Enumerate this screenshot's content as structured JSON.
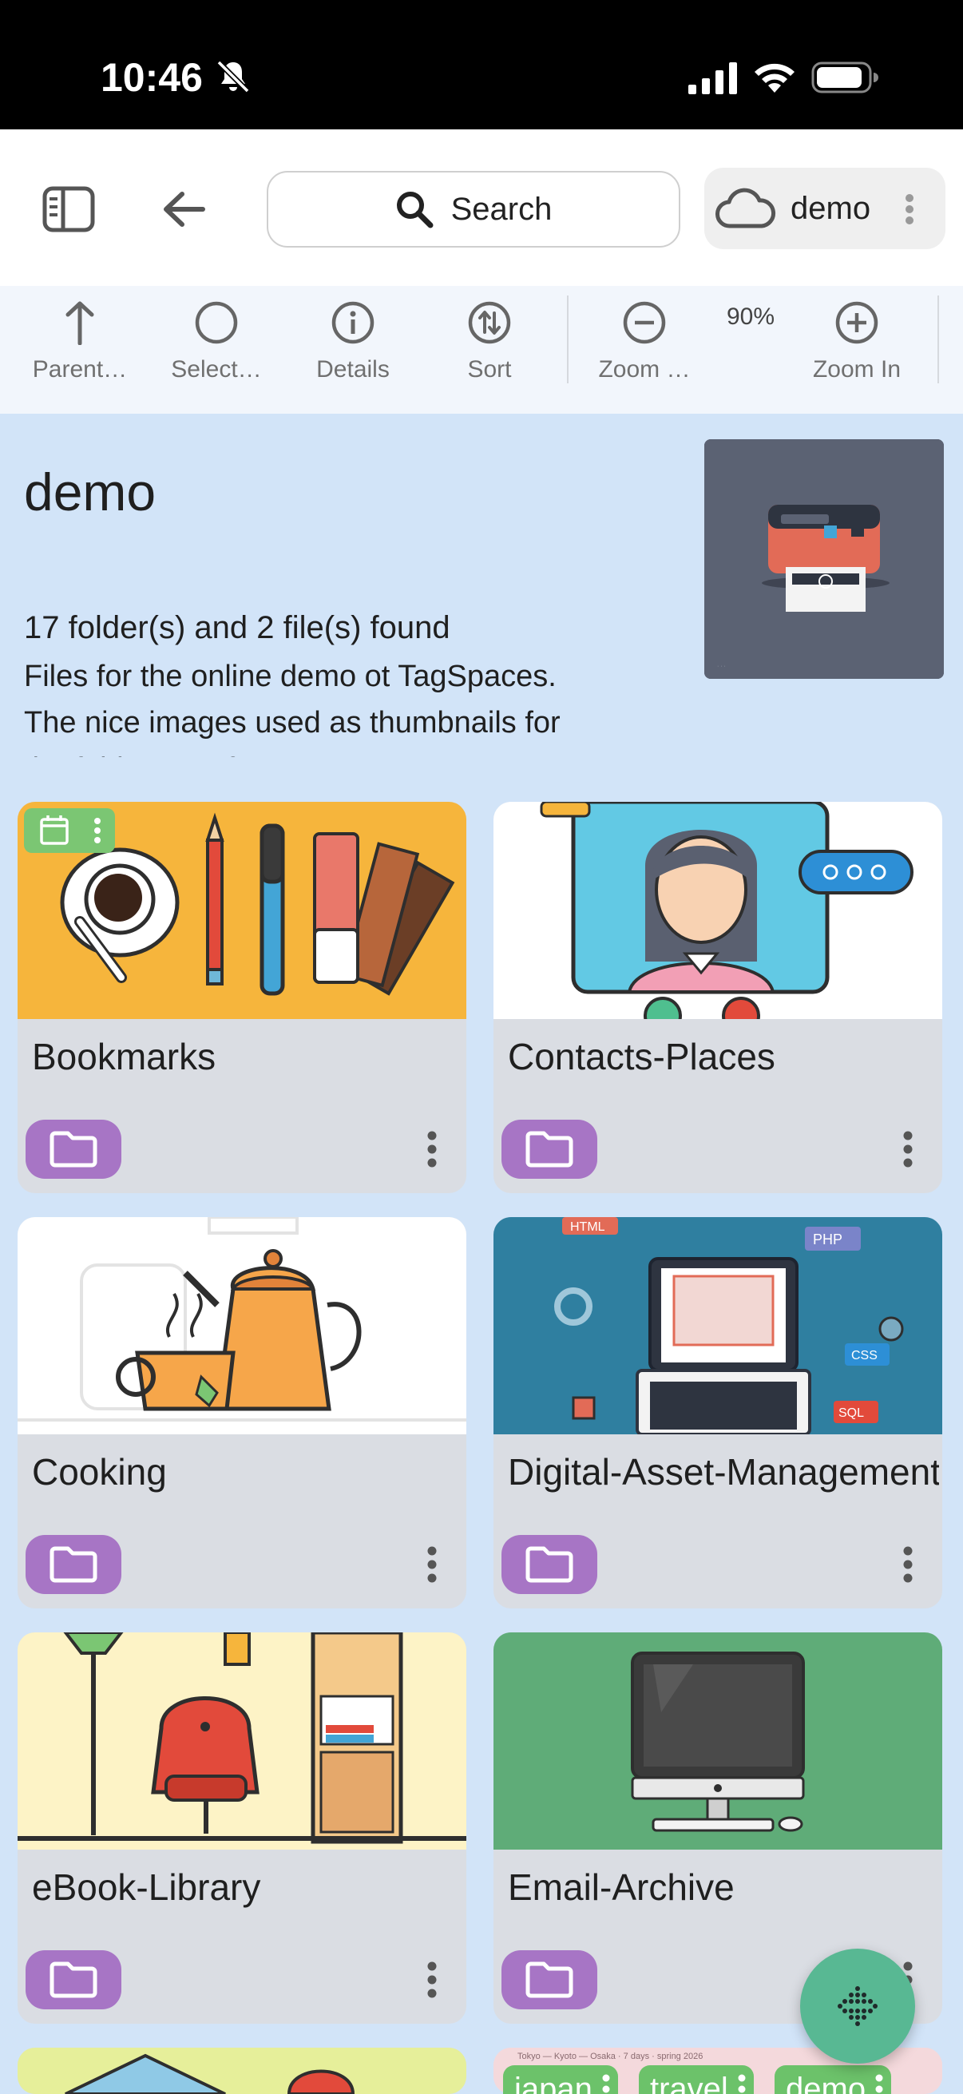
{
  "status_bar": {
    "time": "10:46"
  },
  "header": {
    "search_label": "Search",
    "location_label": "demo"
  },
  "toolbar": {
    "parent": "Parent…",
    "select": "Select…",
    "details": "Details",
    "sort": "Sort",
    "zoom_out": "Zoom …",
    "zoom_level": "90%",
    "zoom_in": "Zoom In"
  },
  "folder": {
    "title": "demo",
    "count": "17 folder(s) and 2 file(s) found",
    "description": "Files for the online demo ot TagSpaces. The nice images used as thumbnails for the folders are from"
  },
  "entries": [
    {
      "name": "Bookmarks"
    },
    {
      "name": "Contacts-Places"
    },
    {
      "name": "Cooking"
    },
    {
      "name": "Digital-Asset-Management"
    },
    {
      "name": "eBook-Library"
    },
    {
      "name": "Email-Archive"
    }
  ],
  "tags": [
    "japan",
    "travel",
    "demo"
  ],
  "colors": {
    "accent_purple": "#a775c5",
    "tag_green": "#6cc26a",
    "fab_green": "#58b893",
    "background": "#d2e4f8"
  }
}
